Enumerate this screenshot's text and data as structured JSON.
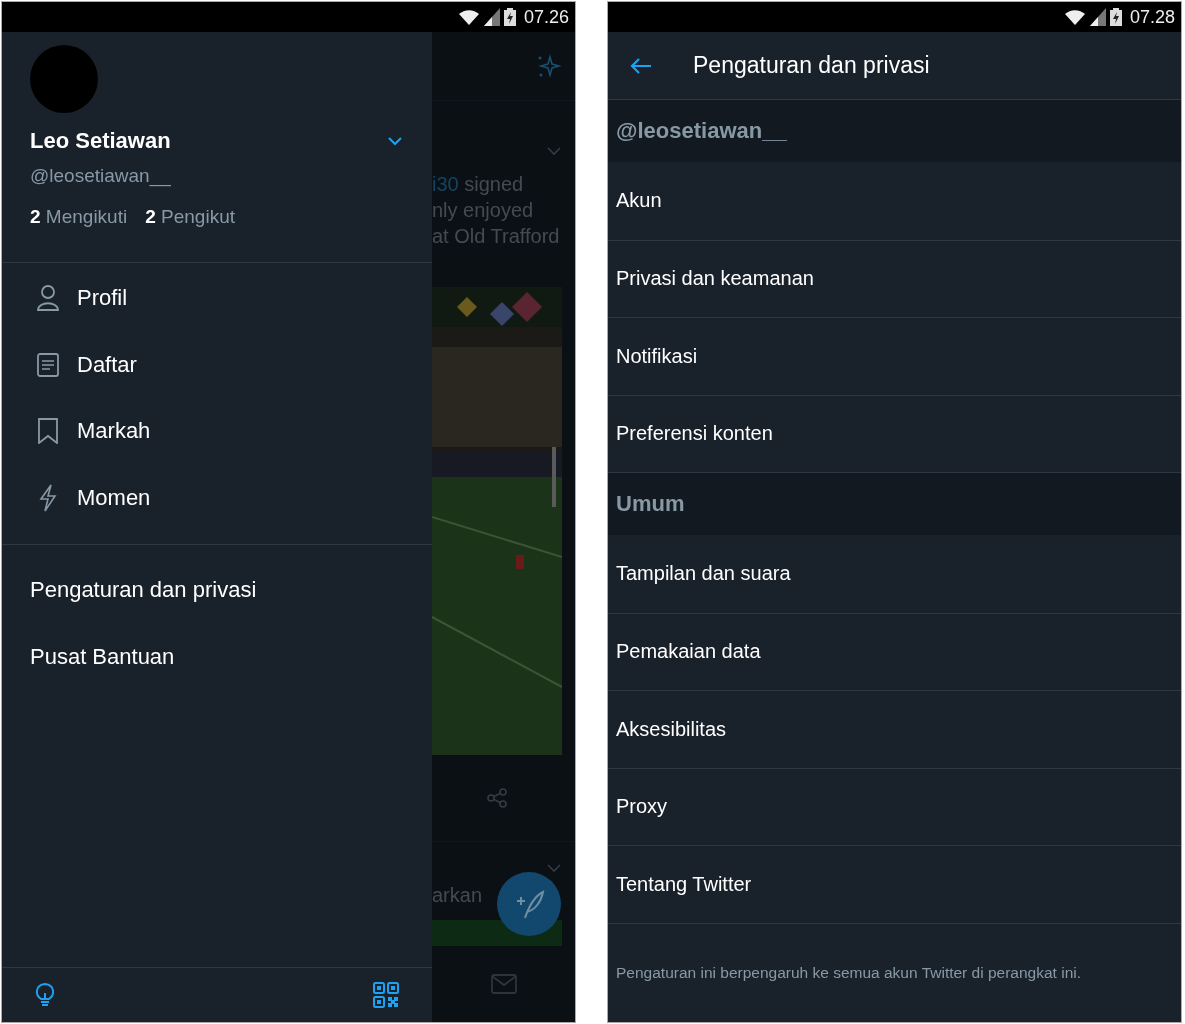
{
  "left_screen": {
    "status_bar": {
      "time": "07.26"
    },
    "drawer": {
      "name": "Leo Setiawan",
      "handle": "@leosetiawan__",
      "stats": [
        {
          "count": "2",
          "label": "Mengikuti"
        },
        {
          "count": "2",
          "label": "Pengikut"
        }
      ],
      "menu": [
        {
          "kind": "person",
          "label": "Profil"
        },
        {
          "kind": "list",
          "label": "Daftar"
        },
        {
          "kind": "bookmark",
          "label": "Markah"
        },
        {
          "kind": "bolt",
          "label": "Momen"
        }
      ],
      "links": [
        {
          "label": "Pengaturan dan privasi"
        },
        {
          "label": "Pusat Bantuan"
        }
      ]
    },
    "feed": {
      "tweet_lines": [
        {
          "mention": "i30",
          "text": " signed"
        },
        {
          "text": "nly enjoyed"
        },
        {
          "text": "at Old Trafford"
        }
      ],
      "second_tweet": "arkan"
    }
  },
  "right_screen": {
    "status_bar": {
      "time": "07.28"
    },
    "title": "Pengaturan dan privasi",
    "rows": [
      {
        "kind": "header",
        "label": "@leosetiawan__"
      },
      {
        "kind": "item",
        "label": "Akun"
      },
      {
        "kind": "item",
        "label": "Privasi dan keamanan"
      },
      {
        "kind": "item",
        "label": "Notifikasi"
      },
      {
        "kind": "item",
        "label": "Preferensi konten"
      },
      {
        "kind": "header",
        "label": "Umum"
      },
      {
        "kind": "item",
        "label": "Tampilan dan suara"
      },
      {
        "kind": "item",
        "label": "Pemakaian data"
      },
      {
        "kind": "item",
        "label": "Aksesibilitas"
      },
      {
        "kind": "item",
        "label": "Proxy"
      },
      {
        "kind": "item",
        "label": "Tentang Twitter"
      }
    ],
    "footer_note": "Pengaturan ini berpengaruh ke semua akun Twitter di perangkat ini."
  }
}
